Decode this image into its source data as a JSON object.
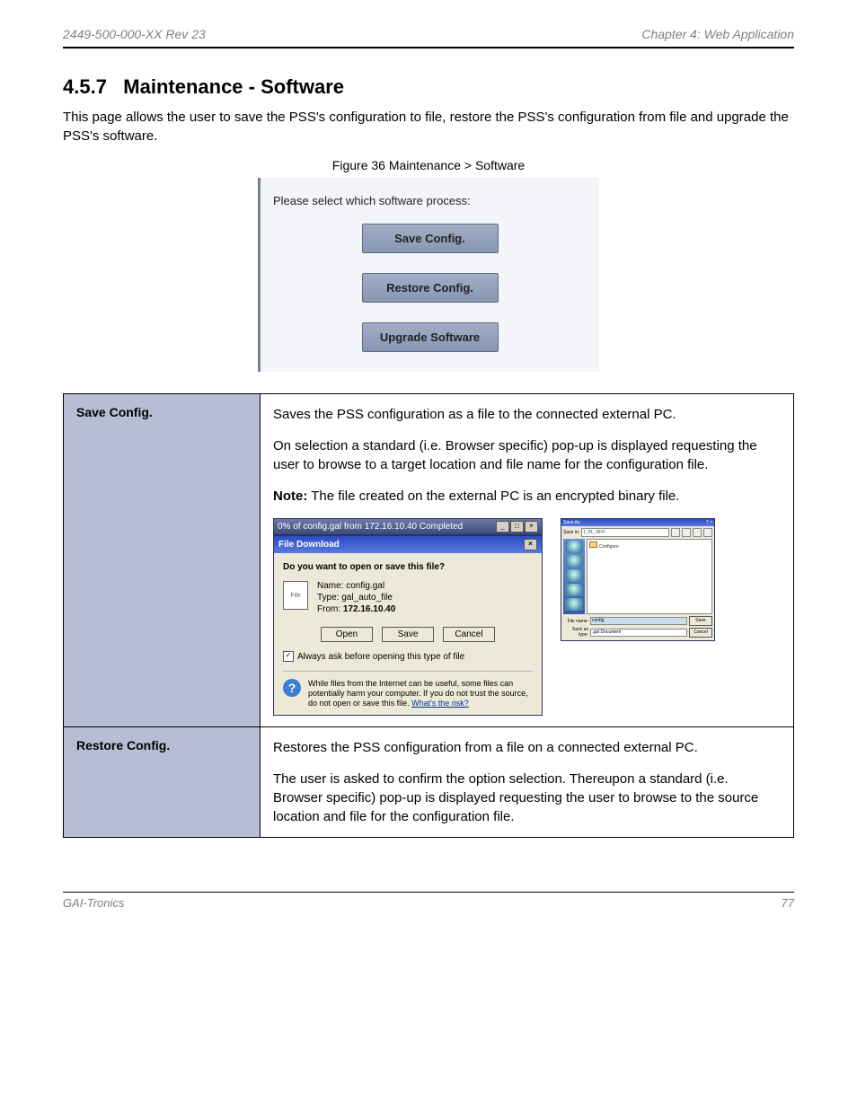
{
  "header": {
    "left": "2449-500-000-XX Rev 23",
    "right": "Chapter 4:    Web Application"
  },
  "section": {
    "number": "4.5.7",
    "title": "Maintenance - Software",
    "intro": "This page allows the user to save the PSS's configuration to file, restore the PSS's configuration from file and upgrade the PSS's software.",
    "figure_caption": "Figure 36   Maintenance > Software",
    "panel_prompt": "Please select which software process:",
    "buttons": {
      "save": "Save Config.",
      "restore": "Restore Config.",
      "upgrade": "Upgrade Software"
    }
  },
  "table": {
    "save": {
      "key": "Save Config.",
      "desc_p1": "Saves the PSS configuration as a file to the connected external PC.",
      "desc_p2": "On selection a standard (i.e. Browser specific) pop-up is displayed requesting the user to browse to a target location and file name for the configuration file.",
      "note_label": "Note:",
      "note": " The file created on the external PC is an encrypted binary file.",
      "dlg": {
        "progress_title": "0% of config.gal from 172.16.10.40 Completed",
        "title": "File Download",
        "question": "Do you want to open or save this file?",
        "name_label": "Name:",
        "name_value": "config.gal",
        "type_label": "Type:",
        "type_value": "gal_auto_file",
        "from_label": "From:",
        "from_value": "172.16.10.40",
        "btn_open": "Open",
        "btn_save": "Save",
        "btn_cancel": "Cancel",
        "checkbox_label": "Always ask before opening this type of file",
        "warn_text": "While files from the Internet can be useful, some files can potentially harm your computer. If you do not trust the source, do not open or save this file. ",
        "warn_link": "What's the risk?"
      },
      "saveas": {
        "title": "Save As",
        "savein_label": "Save in:",
        "savein_value": "1_PL_RFP",
        "list_item": "Configure",
        "filename_label": "File name:",
        "filename_value": "config",
        "savetype_label": "Save as type:",
        "savetype_value": ".gal Document",
        "btn_save": "Save",
        "btn_cancel": "Cancel"
      }
    },
    "restore": {
      "key": "Restore Config.",
      "p1": "Restores the PSS configuration from a file on a connected external PC.",
      "p2": "The user is asked to confirm the option selection. Thereupon a standard (i.e. Browser specific) pop-up is displayed requesting the user to browse to the source location and file for the configuration file."
    }
  },
  "footer": {
    "left": "GAI-Tronics",
    "right": "77"
  }
}
